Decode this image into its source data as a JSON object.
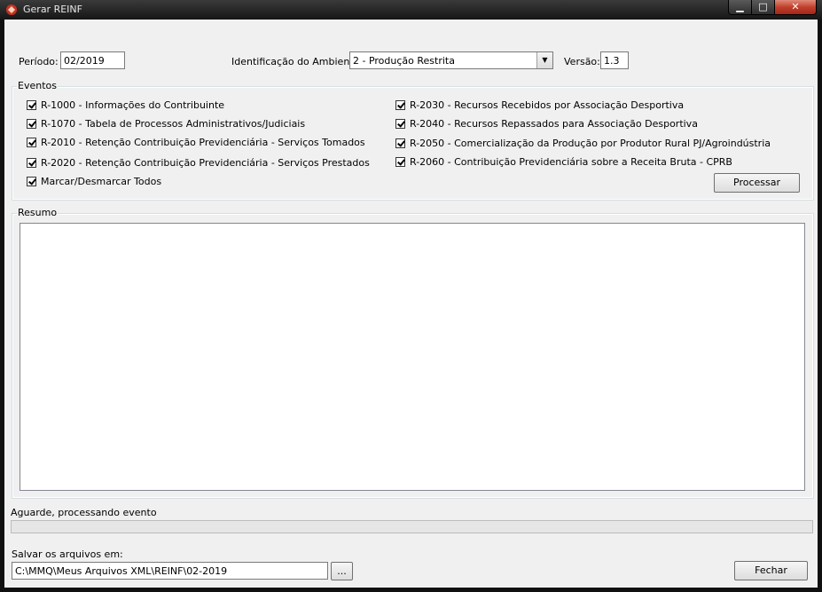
{
  "window": {
    "title": "Gerar REINF",
    "min_glyph": "▁",
    "max_glyph": "□",
    "close_glyph": "✕"
  },
  "form": {
    "periodo_label": "Período:",
    "periodo_value": "02/2019",
    "ambiente_label": "Identificação do Ambiente:",
    "ambiente_value": "2 - Produção Restrita",
    "versao_label": "Versão:",
    "versao_value": "1.3"
  },
  "eventos": {
    "legend": "Eventos",
    "items": [
      {
        "label": "R-1000 - Informações do Contribuinte",
        "checked": true
      },
      {
        "label": "R-1070 - Tabela de Processos Administrativos/Judiciais",
        "checked": true
      },
      {
        "label": "R-2010 - Retenção Contribuição Previdenciária - Serviços Tomados",
        "checked": true
      },
      {
        "label": "R-2020 - Retenção Contribuição Previdenciária - Serviços Prestados",
        "checked": true
      },
      {
        "label": "Marcar/Desmarcar Todos",
        "checked": true
      },
      {
        "label": "R-2030 - Recursos Recebidos por Associação Desportiva",
        "checked": true
      },
      {
        "label": "R-2040 - Recursos Repassados para Associação Desportiva",
        "checked": true
      },
      {
        "label": "R-2050 - Comercialização da Produção por Produtor Rural PJ/Agroindústria",
        "checked": true
      },
      {
        "label": "R-2060 - Contribuição Previdenciária sobre a Receita Bruta - CPRB",
        "checked": true
      }
    ],
    "processar_label": "Processar"
  },
  "resumo": {
    "legend": "Resumo",
    "content": ""
  },
  "status": {
    "text": "Aguarde, processando evento",
    "progress": 0
  },
  "save": {
    "label": "Salvar os arquivos em:",
    "path_value": "C:\\MMQ\\Meus Arquivos XML\\REINF\\02-2019",
    "browse_label": "...",
    "fechar_label": "Fechar"
  },
  "colors": {
    "title_bar": "#1e1e1e",
    "close_button": "#c0402c",
    "face": "#f0f0f0",
    "progress_fill": "#06b025"
  },
  "icons": {
    "app": "reinf-app-icon",
    "dropdown": "chevron-down-icon"
  }
}
